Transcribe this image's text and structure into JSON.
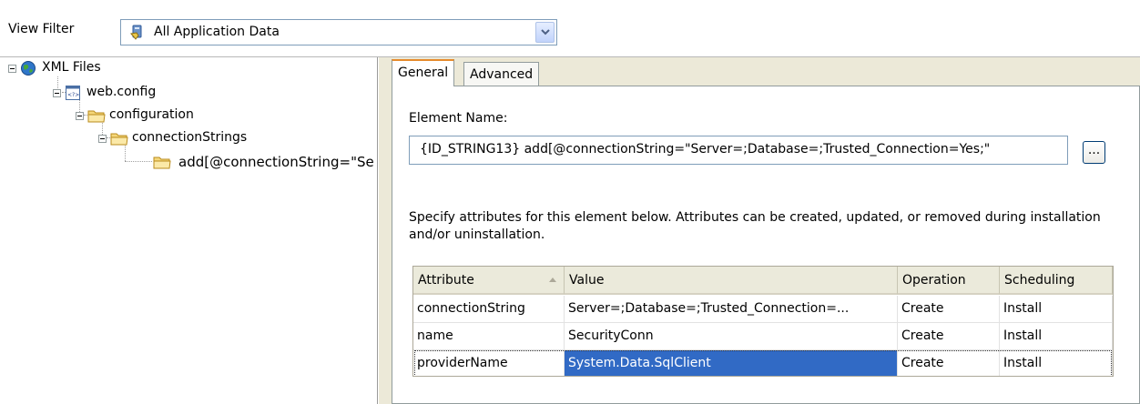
{
  "view_filter": {
    "label": "View Filter",
    "selected": "All Application Data",
    "icon": "app-data-icon"
  },
  "tree": {
    "root": {
      "label": "XML Files",
      "icon": "globe-icon"
    },
    "file": {
      "label": "web.config",
      "icon": "xml-file-icon"
    },
    "n1": {
      "label": "configuration",
      "icon": "folder-icon"
    },
    "n2": {
      "label": "connectionStrings",
      "icon": "folder-icon"
    },
    "n3": {
      "label": "add[@connectionString=\"Se",
      "icon": "folder-icon"
    }
  },
  "tabs": {
    "general": "General",
    "advanced": "Advanced"
  },
  "general": {
    "element_name_label": "Element Name:",
    "element_name_value": "{ID_STRING13} add[@connectionString=\"Server=;Database=;Trusted_Connection=Yes;\"",
    "browse_label": "...",
    "description": "Specify attributes for this element below. Attributes can be created, updated, or removed during installation and/or uninstallation."
  },
  "grid": {
    "columns": {
      "attribute": "Attribute",
      "value": "Value",
      "operation": "Operation",
      "scheduling": "Scheduling"
    },
    "rows": [
      {
        "attribute": "connectionString",
        "value": "Server=;Database=;Trusted_Connection=...",
        "operation": "Create",
        "scheduling": "Install"
      },
      {
        "attribute": "name",
        "value": "SecurityConn",
        "operation": "Create",
        "scheduling": "Install"
      },
      {
        "attribute": "providerName",
        "value": "System.Data.SqlClient",
        "operation": "Create",
        "scheduling": "Install"
      }
    ]
  },
  "colors": {
    "selection": "#316ac5",
    "tab_highlight": "#e68b2c",
    "panel_bg": "#ece9d8"
  }
}
